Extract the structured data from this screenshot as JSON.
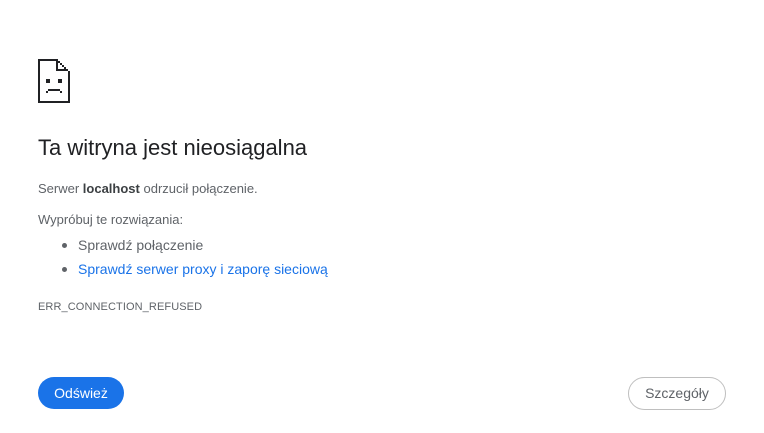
{
  "page": {
    "icon": "sad-document-icon",
    "title": "Ta witryna jest nieosiągalna",
    "description": {
      "prefix": "Serwer ",
      "host": "localhost",
      "suffix": " odrzucił połączenie."
    },
    "try_heading": "Wypróbuj te rozwiązania:",
    "suggestions": [
      {
        "label": "Sprawdź połączenie",
        "is_link": false
      },
      {
        "label": "Sprawdź serwer proxy i zaporę sieciową",
        "is_link": true
      }
    ],
    "error_code": "ERR_CONNECTION_REFUSED"
  },
  "buttons": {
    "reload_label": "Odśwież",
    "details_label": "Szczegóły"
  },
  "colors": {
    "accent": "#1a73e8",
    "text_primary": "#202124",
    "text_secondary": "#5f6368"
  }
}
